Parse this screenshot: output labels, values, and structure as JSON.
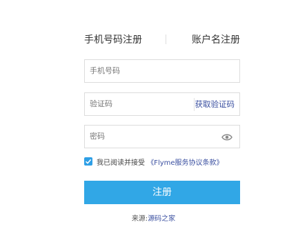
{
  "tabs": {
    "phone_register": "手机号码注册",
    "account_register": "账户名注册"
  },
  "form": {
    "phone_placeholder": "手机号码",
    "code_placeholder": "验证码",
    "get_code_label": "获取验证码",
    "password_placeholder": "密码"
  },
  "agreement": {
    "checked": true,
    "prefix": "我已阅读并接受",
    "link": "《Flyme服务协议条款》"
  },
  "submit_label": "注册",
  "source": {
    "prefix": "来源:",
    "link": "源码之家"
  },
  "colors": {
    "accent": "#31a7e6",
    "link": "#3a4fa0",
    "border": "#dcdcdc"
  },
  "icons": {
    "password_toggle": "eye-icon",
    "checkbox": "checkmark-icon"
  }
}
